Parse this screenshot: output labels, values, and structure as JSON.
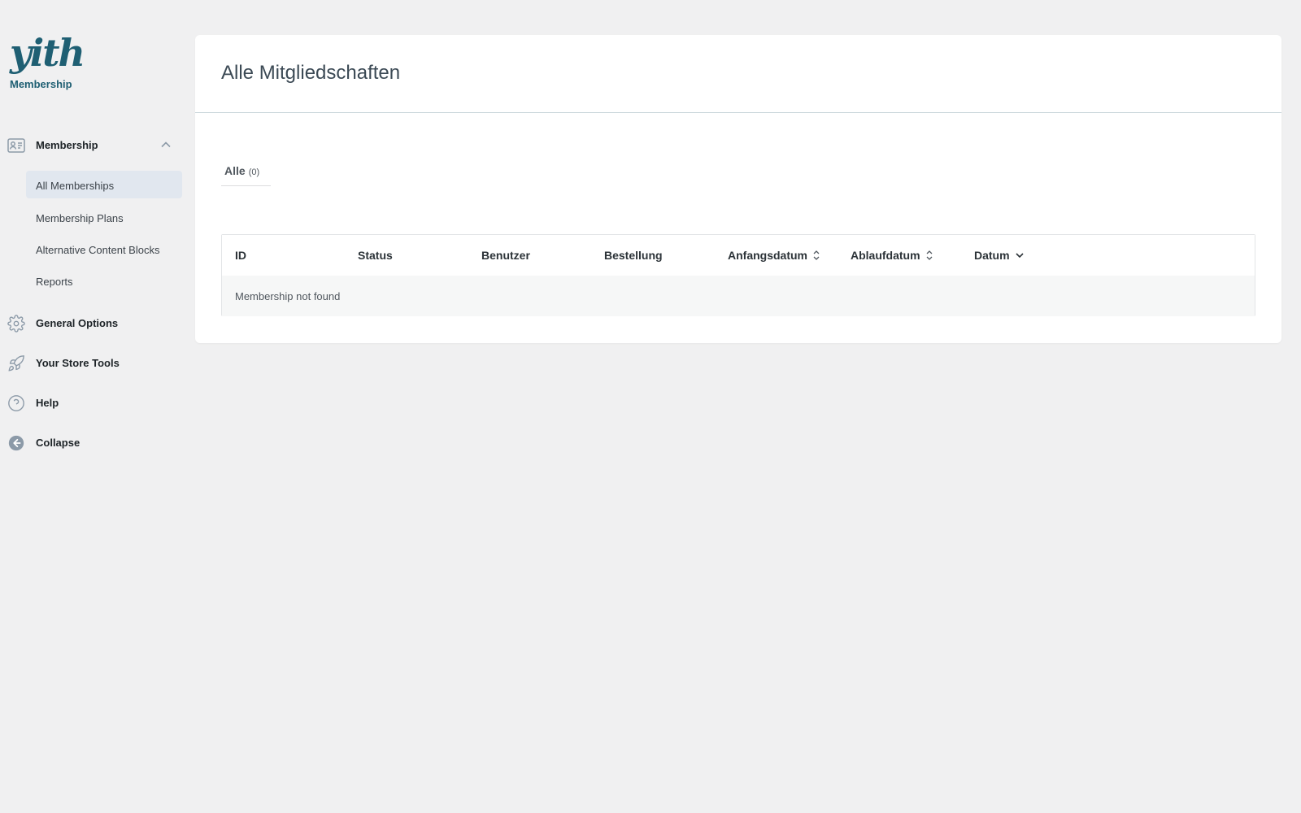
{
  "brand": {
    "logo_text": "yith",
    "subtitle": "Membership"
  },
  "sidebar": {
    "section": {
      "label": "Membership",
      "icon": "id-card-icon",
      "expanded": true,
      "items": [
        {
          "label": "All Memberships",
          "active": true
        },
        {
          "label": "Membership Plans",
          "active": false
        },
        {
          "label": "Alternative Content Blocks",
          "active": false
        },
        {
          "label": "Reports",
          "active": false
        }
      ]
    },
    "general_options": {
      "label": "General Options",
      "icon": "gear-icon"
    },
    "store_tools": {
      "label": "Your Store Tools",
      "icon": "rocket-icon"
    },
    "help": {
      "label": "Help",
      "icon": "question-icon"
    },
    "collapse": {
      "label": "Collapse",
      "icon": "arrow-left-circle-icon"
    }
  },
  "main": {
    "title": "Alle Mitgliedschaften",
    "filter": {
      "label": "Alle",
      "count": "(0)"
    },
    "table": {
      "columns": [
        {
          "label": "ID",
          "sort": "none"
        },
        {
          "label": "Status",
          "sort": "none"
        },
        {
          "label": "Benutzer",
          "sort": "none"
        },
        {
          "label": "Bestellung",
          "sort": "none"
        },
        {
          "label": "Anfangsdatum",
          "sort": "sortable"
        },
        {
          "label": "Ablaufdatum",
          "sort": "sortable"
        },
        {
          "label": "Datum",
          "sort": "desc"
        }
      ],
      "empty_message": "Membership not found"
    }
  },
  "colors": {
    "background": "#f0f0f1",
    "card": "#ffffff",
    "brand": "#1f5f73",
    "active_item": "#e1e7ef",
    "icon": "#8c9aa8"
  }
}
